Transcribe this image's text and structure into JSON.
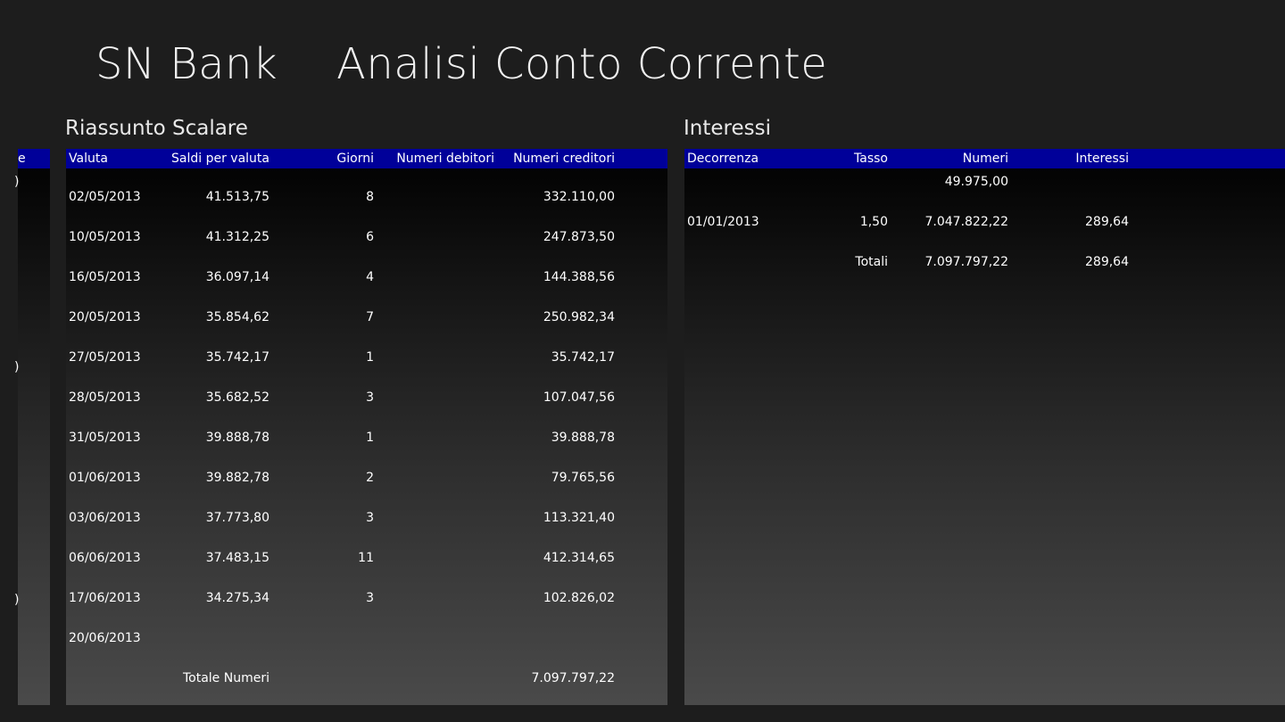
{
  "header": {
    "app_title": "SN Bank",
    "page_title": "Analisi Conto Corrente"
  },
  "left_partial": {
    "header_text": "e",
    "fragments": [
      ")",
      ")",
      ")"
    ]
  },
  "scalare": {
    "title": "Riassunto Scalare",
    "columns": [
      "Valuta",
      "Saldi per valuta",
      "Giorni",
      "Numeri debitori",
      "Numeri creditori"
    ],
    "rows": [
      {
        "valuta": "02/05/2013",
        "saldo": "41.513,75",
        "giorni": "8",
        "debitori": "",
        "creditori": "332.110,00"
      },
      {
        "valuta": "10/05/2013",
        "saldo": "41.312,25",
        "giorni": "6",
        "debitori": "",
        "creditori": "247.873,50"
      },
      {
        "valuta": "16/05/2013",
        "saldo": "36.097,14",
        "giorni": "4",
        "debitori": "",
        "creditori": "144.388,56"
      },
      {
        "valuta": "20/05/2013",
        "saldo": "35.854,62",
        "giorni": "7",
        "debitori": "",
        "creditori": "250.982,34"
      },
      {
        "valuta": "27/05/2013",
        "saldo": "35.742,17",
        "giorni": "1",
        "debitori": "",
        "creditori": "35.742,17"
      },
      {
        "valuta": "28/05/2013",
        "saldo": "35.682,52",
        "giorni": "3",
        "debitori": "",
        "creditori": "107.047,56"
      },
      {
        "valuta": "31/05/2013",
        "saldo": "39.888,78",
        "giorni": "1",
        "debitori": "",
        "creditori": "39.888,78"
      },
      {
        "valuta": "01/06/2013",
        "saldo": "39.882,78",
        "giorni": "2",
        "debitori": "",
        "creditori": "79.765,56"
      },
      {
        "valuta": "03/06/2013",
        "saldo": "37.773,80",
        "giorni": "3",
        "debitori": "",
        "creditori": "113.321,40"
      },
      {
        "valuta": "06/06/2013",
        "saldo": "37.483,15",
        "giorni": "11",
        "debitori": "",
        "creditori": "412.314,65"
      },
      {
        "valuta": "17/06/2013",
        "saldo": "34.275,34",
        "giorni": "3",
        "debitori": "",
        "creditori": "102.826,02"
      },
      {
        "valuta": "20/06/2013",
        "saldo": "",
        "giorni": "",
        "debitori": "",
        "creditori": ""
      }
    ],
    "total_label": "Totale Numeri",
    "total_value": "7.097.797,22"
  },
  "interessi": {
    "title": "Interessi",
    "columns": [
      "Decorrenza",
      "Tasso",
      "Numeri",
      "Interessi"
    ],
    "rows": [
      {
        "decorrenza": "",
        "tasso": "",
        "numeri": "49.975,00",
        "interessi": ""
      },
      {
        "decorrenza": "01/01/2013",
        "tasso": "1,50",
        "numeri": "7.047.822,22",
        "interessi": "289,64"
      },
      {
        "decorrenza": "",
        "tasso": "Totali",
        "numeri": "7.097.797,22",
        "interessi": "289,64"
      }
    ]
  },
  "colors": {
    "background": "#1d1d1d",
    "header_bar": "#000099",
    "text": "#ffffff"
  }
}
